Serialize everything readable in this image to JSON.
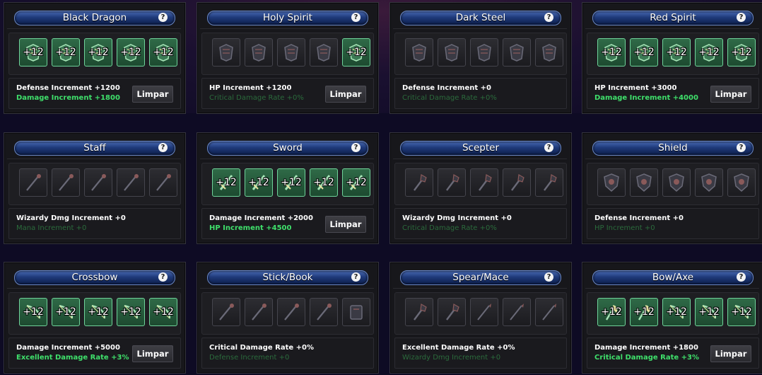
{
  "help_symbol": "?",
  "colors": {
    "active_slot": "#2f6a47",
    "active_text": "#3fe06b",
    "inactive_text": "#2b6b3c",
    "title_bar": "#1f3a7a"
  },
  "sets": [
    {
      "title": "Black Dragon",
      "items": [
        {
          "icon": "armor-helm-icon",
          "level": "+12",
          "active": true
        },
        {
          "icon": "armor-chest-icon",
          "level": "+12",
          "active": true
        },
        {
          "icon": "armor-gloves-icon",
          "level": "+12",
          "active": true
        },
        {
          "icon": "armor-pants-icon",
          "level": "+12",
          "active": true
        },
        {
          "icon": "armor-boots-icon",
          "level": "+12",
          "active": true
        }
      ],
      "stat_primary": "Defense Increment +1200",
      "stat_secondary": "Damage Increment +1800",
      "secondary_active": true,
      "clear_label": "Limpar"
    },
    {
      "title": "Holy Spirit",
      "items": [
        {
          "icon": "armor-helm-icon",
          "level": "",
          "active": false
        },
        {
          "icon": "armor-chest-icon",
          "level": "",
          "active": false
        },
        {
          "icon": "armor-gloves-icon",
          "level": "",
          "active": false
        },
        {
          "icon": "armor-pants-icon",
          "level": "",
          "active": false
        },
        {
          "icon": "armor-boots-icon",
          "level": "+12",
          "active": true
        }
      ],
      "stat_primary": "HP Increment +1200",
      "stat_secondary": "Critical Damage Rate +0%",
      "secondary_active": false,
      "clear_label": "Limpar"
    },
    {
      "title": "Dark Steel",
      "items": [
        {
          "icon": "armor-helm-icon",
          "level": "",
          "active": false
        },
        {
          "icon": "armor-chest-icon",
          "level": "",
          "active": false
        },
        {
          "icon": "armor-gloves-icon",
          "level": "",
          "active": false
        },
        {
          "icon": "armor-pants-icon",
          "level": "",
          "active": false
        },
        {
          "icon": "armor-boots-icon",
          "level": "",
          "active": false
        }
      ],
      "stat_primary": "Defense Increment +0",
      "stat_secondary": "Critical Damage Rate +0%",
      "secondary_active": false,
      "clear_label": ""
    },
    {
      "title": "Red Spirit",
      "items": [
        {
          "icon": "armor-helm-icon",
          "level": "+12",
          "active": true
        },
        {
          "icon": "armor-chest-icon",
          "level": "+12",
          "active": true
        },
        {
          "icon": "armor-gloves-icon",
          "level": "+12",
          "active": true
        },
        {
          "icon": "armor-pants-icon",
          "level": "+12",
          "active": true
        },
        {
          "icon": "armor-boots-icon",
          "level": "+12",
          "active": true
        }
      ],
      "stat_primary": "HP Increment +3000",
      "stat_secondary": "Damage Increment +4000",
      "secondary_active": true,
      "clear_label": "Limpar"
    },
    {
      "title": "Staff",
      "items": [
        {
          "icon": "staff-icon",
          "level": "",
          "active": false
        },
        {
          "icon": "staff-icon",
          "level": "",
          "active": false
        },
        {
          "icon": "staff-icon",
          "level": "",
          "active": false
        },
        {
          "icon": "staff-icon",
          "level": "",
          "active": false
        },
        {
          "icon": "staff-icon",
          "level": "",
          "active": false
        }
      ],
      "stat_primary": "Wizardy Dmg Increment +0",
      "stat_secondary": "Mana Increment +0",
      "secondary_active": false,
      "clear_label": ""
    },
    {
      "title": "Sword",
      "items": [
        {
          "icon": "sword-icon",
          "level": "+12",
          "active": true
        },
        {
          "icon": "sword-icon",
          "level": "+12",
          "active": true
        },
        {
          "icon": "sword-icon",
          "level": "+12",
          "active": true
        },
        {
          "icon": "sword-icon",
          "level": "+12",
          "active": true
        },
        {
          "icon": "sword-icon",
          "level": "+12",
          "active": true
        }
      ],
      "stat_primary": "Damage Increment +2000",
      "stat_secondary": "HP Increment +4500",
      "secondary_active": true,
      "clear_label": "Limpar"
    },
    {
      "title": "Scepter",
      "items": [
        {
          "icon": "scepter-icon",
          "level": "",
          "active": false
        },
        {
          "icon": "scepter-icon",
          "level": "",
          "active": false
        },
        {
          "icon": "scepter-icon",
          "level": "",
          "active": false
        },
        {
          "icon": "scepter-icon",
          "level": "",
          "active": false
        },
        {
          "icon": "scepter-icon",
          "level": "",
          "active": false
        }
      ],
      "stat_primary": "Wizardy Dmg Increment +0",
      "stat_secondary": "Critical Damage Rate +0%",
      "secondary_active": false,
      "clear_label": ""
    },
    {
      "title": "Shield",
      "items": [
        {
          "icon": "shield-icon",
          "level": "",
          "active": false
        },
        {
          "icon": "shield-icon",
          "level": "",
          "active": false
        },
        {
          "icon": "shield-icon",
          "level": "",
          "active": false
        },
        {
          "icon": "shield-icon",
          "level": "",
          "active": false
        },
        {
          "icon": "shield-icon",
          "level": "",
          "active": false
        }
      ],
      "stat_primary": "Defense Increment +0",
      "stat_secondary": "HP Increment +0",
      "secondary_active": false,
      "clear_label": ""
    },
    {
      "title": "Crossbow",
      "items": [
        {
          "icon": "crossbow-icon",
          "level": "+12",
          "active": true
        },
        {
          "icon": "crossbow-icon",
          "level": "+12",
          "active": true
        },
        {
          "icon": "crossbow-icon",
          "level": "+12",
          "active": true
        },
        {
          "icon": "crossbow-icon",
          "level": "+12",
          "active": true
        },
        {
          "icon": "crossbow-icon",
          "level": "+12",
          "active": true
        }
      ],
      "stat_primary": "Damage Increment +5000",
      "stat_secondary": "Excellent Damage Rate +3%",
      "secondary_active": true,
      "clear_label": "Limpar"
    },
    {
      "title": "Stick/Book",
      "items": [
        {
          "icon": "stick-icon",
          "level": "",
          "active": false
        },
        {
          "icon": "stick-icon",
          "level": "",
          "active": false
        },
        {
          "icon": "stick-icon",
          "level": "",
          "active": false
        },
        {
          "icon": "stick-icon",
          "level": "",
          "active": false
        },
        {
          "icon": "book-icon",
          "level": "",
          "active": false
        }
      ],
      "stat_primary": "Critical Damage Rate +0%",
      "stat_secondary": "Defense Increment +0",
      "secondary_active": false,
      "clear_label": ""
    },
    {
      "title": "Spear/Mace",
      "items": [
        {
          "icon": "mace-icon",
          "level": "",
          "active": false
        },
        {
          "icon": "mace-icon",
          "level": "",
          "active": false
        },
        {
          "icon": "spear-icon",
          "level": "",
          "active": false
        },
        {
          "icon": "spear-icon",
          "level": "",
          "active": false
        },
        {
          "icon": "spear-icon",
          "level": "",
          "active": false
        }
      ],
      "stat_primary": "Excellent Damage Rate +0%",
      "stat_secondary": "Wizardy Dmg Increment +0",
      "secondary_active": false,
      "clear_label": ""
    },
    {
      "title": "Bow/Axe",
      "items": [
        {
          "icon": "axe-icon",
          "level": "+12",
          "active": true
        },
        {
          "icon": "axe-icon",
          "level": "+12",
          "active": true
        },
        {
          "icon": "bow-icon",
          "level": "+12",
          "active": true
        },
        {
          "icon": "bow-icon",
          "level": "+12",
          "active": true
        },
        {
          "icon": "bow-icon",
          "level": "+12",
          "active": true
        }
      ],
      "stat_primary": "Damage Increment +1800",
      "stat_secondary": "Critical Damage Rate +3%",
      "secondary_active": true,
      "clear_label": "Limpar"
    }
  ]
}
